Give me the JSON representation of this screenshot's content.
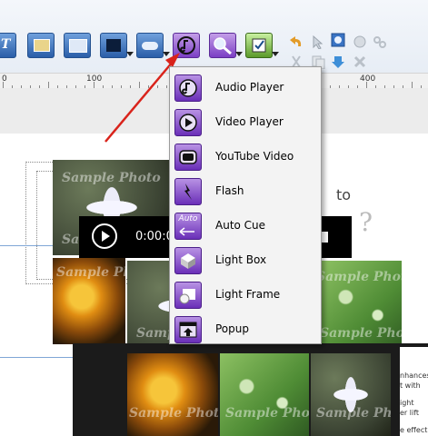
{
  "ruler": {
    "marks": [
      "0",
      "100",
      "400"
    ]
  },
  "menu": {
    "items": [
      {
        "label": "Audio Player",
        "icon": "audio-player-icon"
      },
      {
        "label": "Video Player",
        "icon": "video-player-icon"
      },
      {
        "label": "YouTube Video",
        "icon": "youtube-video-icon"
      },
      {
        "label": "Flash",
        "icon": "flash-icon"
      },
      {
        "label": "Auto Cue",
        "icon": "auto-cue-icon",
        "icon_text": "Auto"
      },
      {
        "label": "Light Box",
        "icon": "light-box-icon"
      },
      {
        "label": "Light Frame",
        "icon": "light-frame-icon"
      },
      {
        "label": "Popup",
        "icon": "popup-icon"
      }
    ]
  },
  "video": {
    "time": "0:00:0"
  },
  "canvas": {
    "side_word": "to",
    "side_glyph": "?",
    "watermark": "Sample Photo",
    "page_text": [
      "nhances",
      "t with",
      "ight",
      "er lift",
      "e effect"
    ]
  },
  "colors": {
    "accent_purple": "#7b3fc4",
    "toolbar_blue": "#2a5ea8",
    "arrow_red": "#d9231b"
  }
}
